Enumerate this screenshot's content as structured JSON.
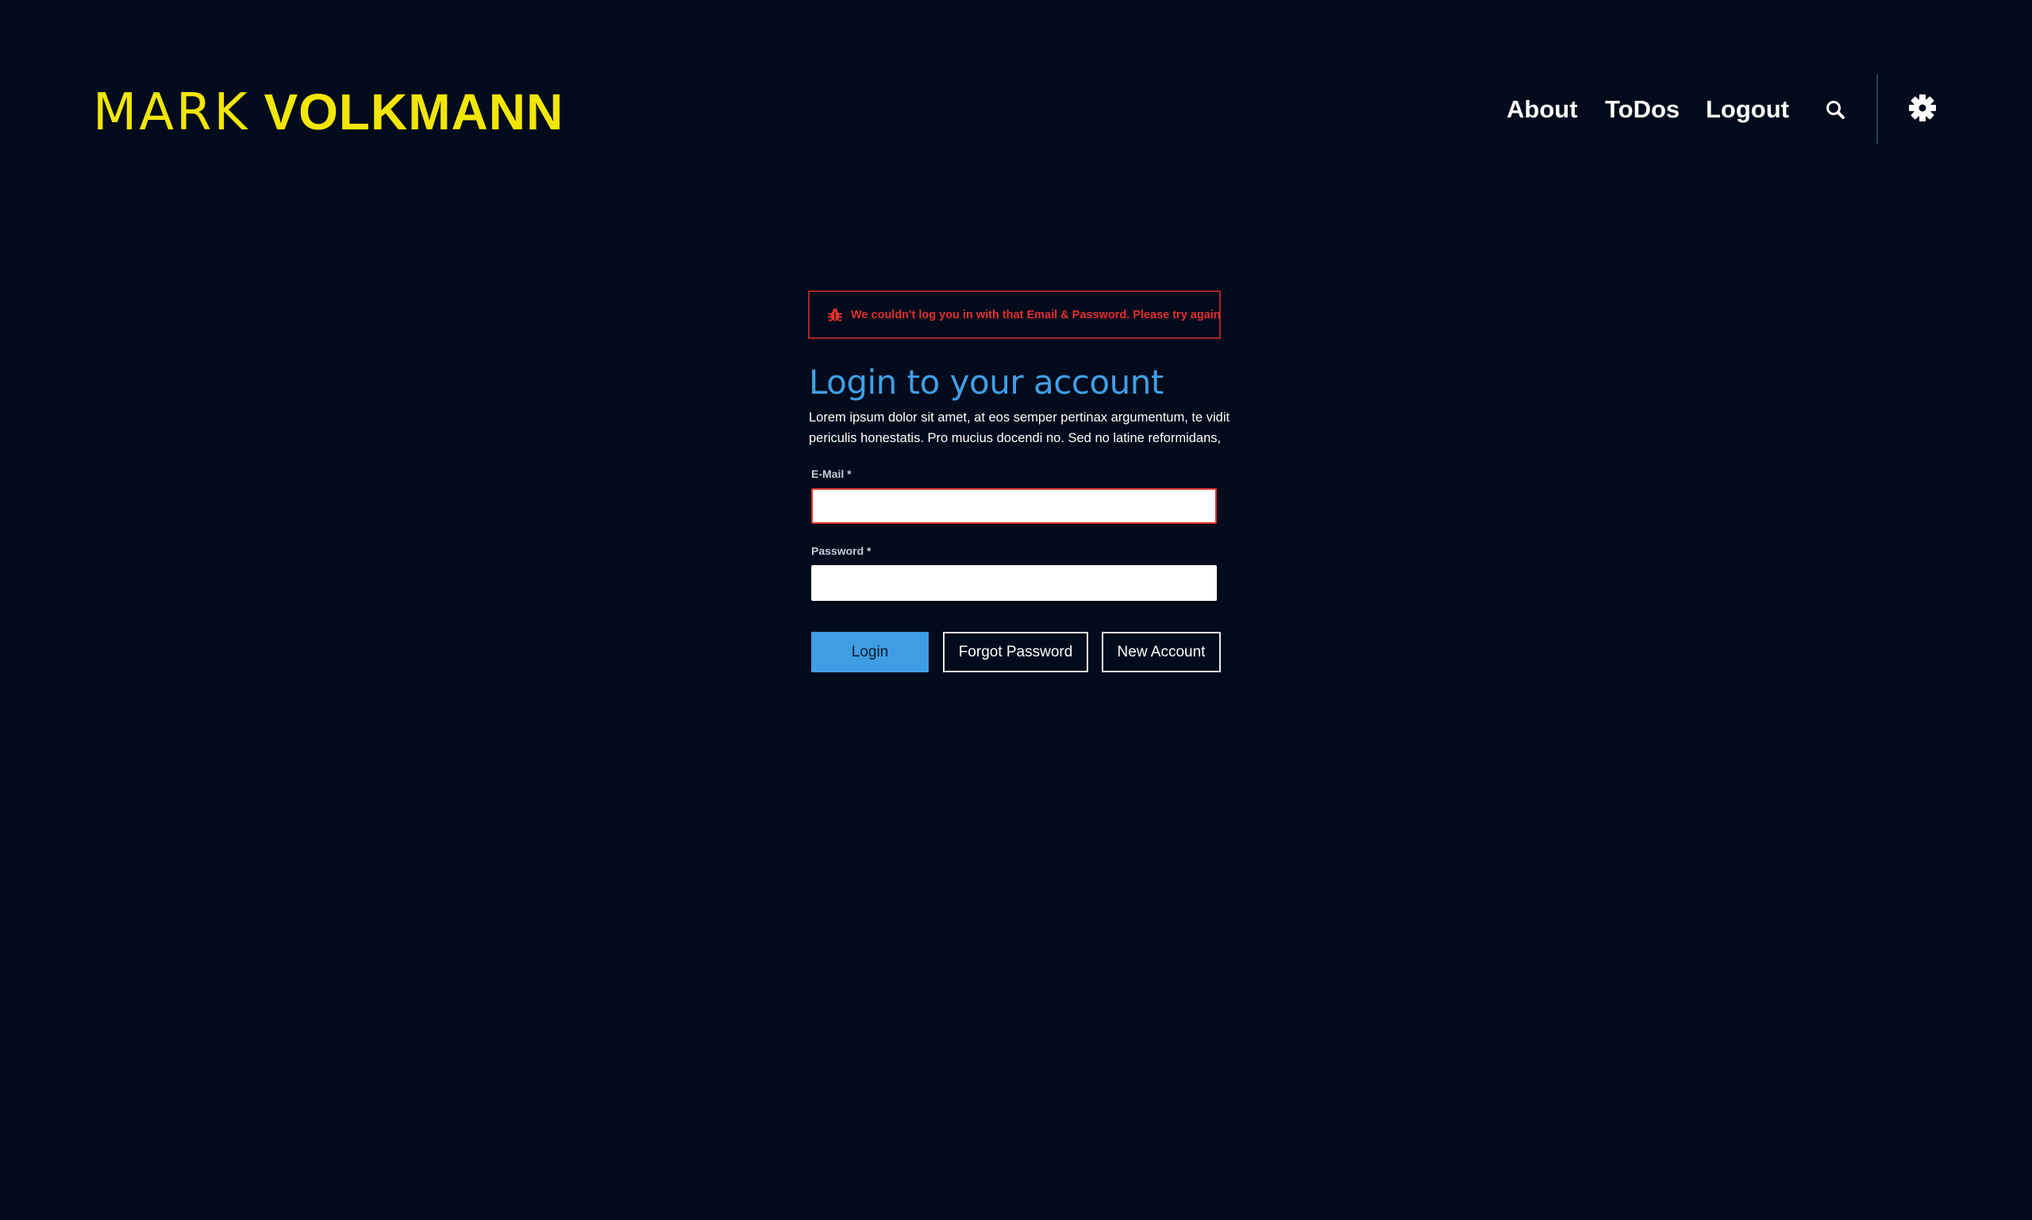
{
  "header": {
    "logo_light": "MARK",
    "logo_bold": "VOLKMANN",
    "nav": {
      "about": "About",
      "todos": "ToDos",
      "logout": "Logout"
    },
    "icons": {
      "search": "search-icon",
      "settings": "gear-icon"
    }
  },
  "alert": {
    "icon": "error-bug-icon",
    "message": "We couldn't log you in with that Email & Password. Please try again"
  },
  "login": {
    "title": "Login to your account",
    "lead": "Lorem ipsum dolor sit amet, at eos semper pertinax argumentum, te vidit periculis honestatis. Pro mucius docendi no. Sed no latine reformidans,",
    "email_label": "E-Mail *",
    "email_value": "",
    "password_label": "Password *",
    "password_value": "",
    "buttons": {
      "login": "Login",
      "forgot": "Forgot Password",
      "new_account": "New Account"
    }
  },
  "colors": {
    "background": "#020b1c",
    "logo": "#f2e605",
    "accent": "#3f9fe6",
    "error": "#e0302e"
  }
}
